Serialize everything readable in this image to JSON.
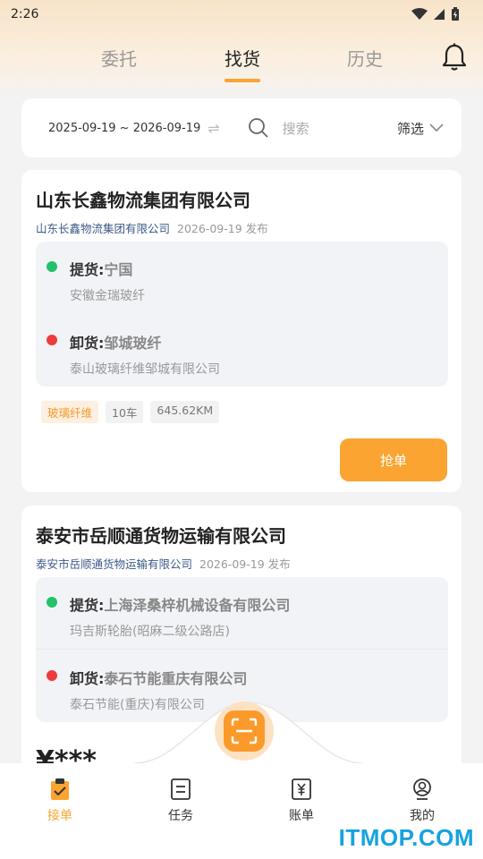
{
  "status_bar": {
    "time": "2:26"
  },
  "tabs": [
    {
      "label": "委托"
    },
    {
      "label": "找货"
    },
    {
      "label": "历史"
    }
  ],
  "search": {
    "date_range": "2025-09-19 ~ 2026-09-19",
    "swap_glyph": "⇌",
    "placeholder": "搜索",
    "filter_label": "筛选"
  },
  "cards": [
    {
      "title": "山东长鑫物流集团有限公司",
      "company": "山东长鑫物流集团有限公司",
      "publish": "2026-09-19 发布",
      "pickup": {
        "prefix": "提货:",
        "place": "宁国",
        "address": "安徽金瑞玻纤"
      },
      "unload": {
        "prefix": "卸货:",
        "place": "邹城玻纤",
        "address": "泰山玻璃纤维邹城有限公司"
      },
      "tags": [
        "玻璃纤维",
        "10车",
        "645.62KM"
      ],
      "button": "抢单"
    },
    {
      "title": "泰安市岳顺通货物运输有限公司",
      "company": "泰安市岳顺通货物运输有限公司",
      "publish": "2026-09-19 发布",
      "pickup": {
        "prefix": "提货:",
        "place": "上海泽桑梓机械设备有限公司",
        "address": "玛吉斯轮胎(昭麻二级公路店)"
      },
      "unload": {
        "prefix": "卸货:",
        "place": "泰石节能重庆有限公司",
        "address": "泰石节能(重庆)有限公司"
      },
      "price": "¥***"
    }
  ],
  "bottom_nav": [
    {
      "label": "接单",
      "icon": "clipboard-check-icon"
    },
    {
      "label": "任务",
      "icon": "list-doc-icon"
    },
    {
      "label": "账单",
      "icon": "yuan-bill-icon"
    },
    {
      "label": "我的",
      "icon": "user-icon"
    }
  ],
  "scan_button": {
    "icon": "scan-icon"
  },
  "watermark": "ITMOP.COM",
  "colors": {
    "accent": "#fba432",
    "link": "#3d5a88",
    "green_dot": "#22c26b",
    "red_dot": "#ee3b3b"
  }
}
